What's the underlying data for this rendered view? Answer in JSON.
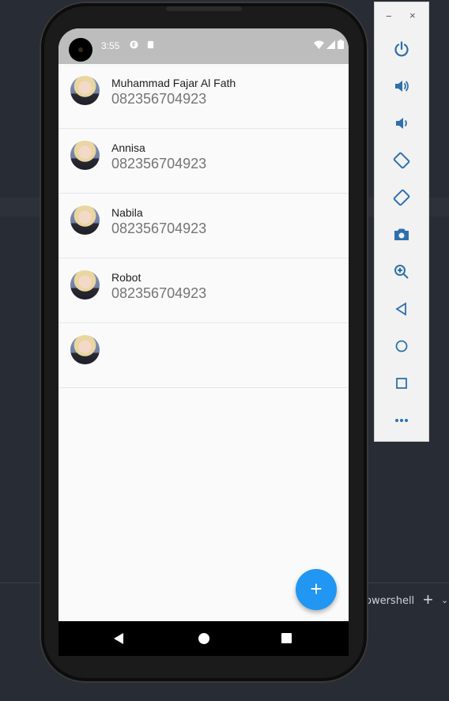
{
  "ide": {
    "terminal_label": "owershell",
    "plus_glyph": "+",
    "chevron_glyph": "⌄"
  },
  "status_bar": {
    "time": "3:55",
    "icons": [
      "flutter-notification-icon",
      "sd-card-icon",
      "wifi-icon",
      "signal-icon",
      "battery-icon"
    ]
  },
  "contacts": [
    {
      "name": "Muhammad Fajar Al Fath",
      "phone": "082356704923"
    },
    {
      "name": "Annisa",
      "phone": "082356704923"
    },
    {
      "name": "Nabila",
      "phone": "082356704923"
    },
    {
      "name": "Robot",
      "phone": "082356704923"
    },
    {
      "name": "",
      "phone": ""
    }
  ],
  "fab": {
    "label": "+",
    "color": "#2196f3"
  },
  "nav_bar": {
    "icons": [
      "back-icon",
      "home-icon",
      "recents-icon"
    ]
  },
  "emulator_panel": {
    "minimize_glyph": "−",
    "close_glyph": "×",
    "buttons": [
      "power-icon",
      "volume-up-icon",
      "volume-down-icon",
      "rotate-left-icon",
      "rotate-right-icon",
      "camera-icon",
      "zoom-icon",
      "back-icon",
      "home-icon",
      "overview-icon",
      "more-icon"
    ]
  },
  "colors": {
    "ide_background": "#282c34",
    "status_bar": "#bdbdbd",
    "screen_background": "#fafafa",
    "accent": "#2196f3"
  }
}
